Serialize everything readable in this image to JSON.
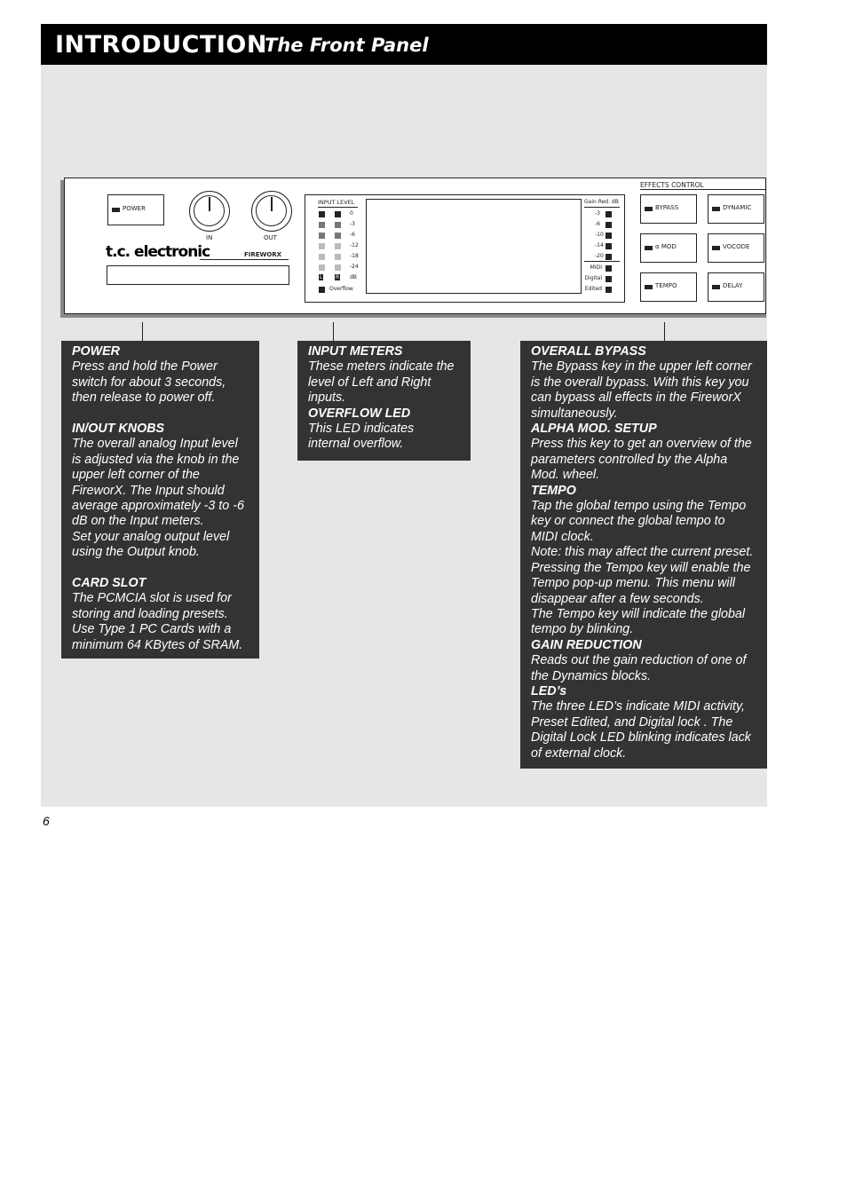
{
  "header": {
    "title": "INTRODUCTION",
    "subtitle": "The Front Panel"
  },
  "panel": {
    "power_label": "POWER",
    "knob_in": "IN",
    "knob_out": "OUT",
    "brand": "t.c. electronic",
    "model": "FIREWORX",
    "input_level_title": "INPUT LEVEL",
    "input_scale": [
      "0",
      "-3",
      "-6",
      "-12",
      "-18",
      "-24",
      "dB"
    ],
    "left": "L",
    "right": "R",
    "overflow": "Overflow",
    "gain_red_title": "Gain Red. dB",
    "gain_scale": [
      "-3",
      "-6",
      "-10",
      "-14",
      "-20"
    ],
    "status_leds": [
      "MIDI",
      "Digital",
      "Edited"
    ],
    "effects_title": "EFFECTS CONTROL",
    "effects_buttons": [
      "BYPASS",
      "DYNAMIC",
      "α MOD",
      "VOCODE",
      "TEMPO",
      "DELAY"
    ]
  },
  "callouts": [
    {
      "blocks": [
        {
          "h": "POWER",
          "lines": [
            "Press and hold the Power",
            "switch for about 3 seconds,",
            "then release to power off."
          ]
        },
        {
          "h": "IN/OUT KNOBS",
          "gap": true,
          "lines": [
            "The overall analog Input level",
            "is adjusted via the knob in the",
            "upper left corner of the",
            "FireworX. The Input should",
            "average approximately -3 to -6",
            "dB on the Input meters.",
            "Set your analog output level",
            "using the Output knob."
          ]
        },
        {
          "h": "CARD SLOT",
          "gap": true,
          "lines": [
            "The PCMCIA slot is used for",
            "storing and loading presets.",
            "Use Type 1 PC Cards with a",
            "minimum 64 KBytes of SRAM."
          ]
        }
      ]
    },
    {
      "blocks": [
        {
          "h": "INPUT METERS",
          "lines": [
            "These meters indicate the",
            "level of Left and Right",
            "inputs."
          ]
        },
        {
          "h": "OVERFLOW LED",
          "lines": [
            "This LED indicates",
            "internal overflow."
          ]
        }
      ]
    },
    {
      "blocks": [
        {
          "h": "OVERALL BYPASS",
          "lines": [
            "The Bypass key in the upper left corner",
            "is the overall bypass. With this key you",
            "can bypass all effects in the FireworX",
            "simultaneously."
          ]
        },
        {
          "h": "ALPHA MOD. SETUP",
          "lines": [
            "Press this key to get an overview of the",
            "parameters controlled by the Alpha",
            "Mod. wheel."
          ]
        },
        {
          "h": "TEMPO",
          "lines": [
            "Tap the global tempo using the Tempo",
            "key or connect the global tempo to",
            "MIDI clock.",
            "Note: this may affect the current preset.",
            "Pressing the Tempo key will enable the",
            "Tempo pop-up menu. This menu will",
            "disappear after a few seconds.",
            "The Tempo key will indicate the global",
            "tempo by blinking."
          ]
        },
        {
          "h": "GAIN REDUCTION",
          "lines": [
            "Reads out the gain reduction of one of",
            "the Dynamics blocks."
          ]
        },
        {
          "h": "LED’s",
          "lines": [
            "The three LED’s indicate MIDI activity,",
            "Preset Edited, and Digital lock . The",
            "Digital Lock LED blinking indicates lack",
            "of external clock."
          ]
        }
      ]
    }
  ],
  "page_number": "6"
}
